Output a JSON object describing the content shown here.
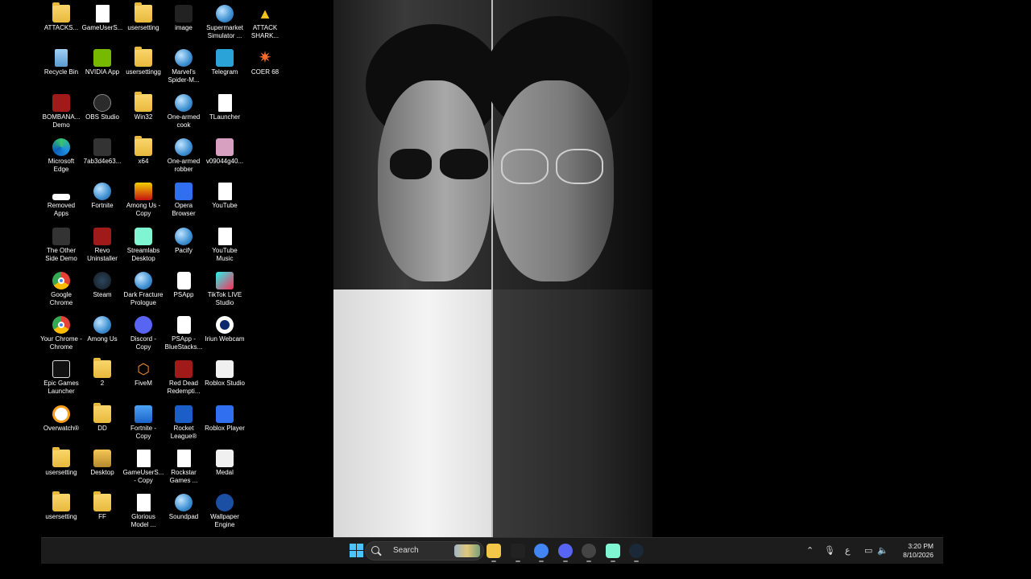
{
  "desktop": {
    "columns": [
      [
        {
          "label": "ATTACKS...",
          "icon": "folder-icon",
          "type": "folder"
        },
        {
          "label": "Recycle Bin",
          "icon": "recycle-bin-icon",
          "type": "recycle"
        },
        {
          "label": "BOMBANA... Demo",
          "icon": "car-game-icon",
          "type": "red"
        },
        {
          "label": "Microsoft Edge",
          "icon": "edge-icon",
          "type": "edge"
        },
        {
          "label": "Removed Apps",
          "icon": "removed-apps-icon",
          "type": "white-sq"
        },
        {
          "label": "The Other Side Demo",
          "icon": "tos-icon",
          "type": "dark"
        },
        {
          "label": "Google Chrome",
          "icon": "chrome-icon",
          "type": "chrome"
        },
        {
          "label": "Your Chrome - Chrome",
          "icon": "chrome-profile-icon",
          "type": "chrome"
        },
        {
          "label": "Epic Games Launcher",
          "icon": "epic-games-icon",
          "type": "epic"
        },
        {
          "label": "Overwatch®",
          "icon": "overwatch-icon",
          "type": "overwatch"
        },
        {
          "label": "usersetting",
          "icon": "folder-icon",
          "type": "folder"
        },
        {
          "label": "usersetting",
          "icon": "folder-icon",
          "type": "folder"
        }
      ],
      [
        {
          "label": "GameUserS...",
          "icon": "settings-file-icon",
          "type": "doc"
        },
        {
          "label": "NVIDIA App",
          "icon": "nvidia-icon",
          "type": "nvidia"
        },
        {
          "label": "OBS Studio",
          "icon": "obs-icon",
          "type": "obs"
        },
        {
          "label": "7ab3d4e63...",
          "icon": "app-icon",
          "type": "dark"
        },
        {
          "label": "Fortnite",
          "icon": "globe-icon",
          "type": "globe"
        },
        {
          "label": "Revo Uninstaller",
          "icon": "revo-icon",
          "type": "red"
        },
        {
          "label": "Steam",
          "icon": "steam-icon",
          "type": "steam"
        },
        {
          "label": "Among Us",
          "icon": "globe-icon",
          "type": "globe"
        },
        {
          "label": "2",
          "icon": "folder-icon",
          "type": "folder"
        },
        {
          "label": "DD",
          "icon": "folder-icon",
          "type": "folder"
        },
        {
          "label": "Desktop",
          "icon": "desktop-folder-icon",
          "type": "desktop-ico"
        },
        {
          "label": "FF",
          "icon": "folder-icon",
          "type": "folder"
        }
      ],
      [
        {
          "label": "usersetting",
          "icon": "folder-icon",
          "type": "folder"
        },
        {
          "label": "usersettingg",
          "icon": "folder-icon",
          "type": "folder"
        },
        {
          "label": "Win32",
          "icon": "folder-icon",
          "type": "folder"
        },
        {
          "label": "x64",
          "icon": "folder-icon",
          "type": "folder"
        },
        {
          "label": "Among Us - Copy",
          "icon": "among-us-icon",
          "type": "among-copy"
        },
        {
          "label": "Streamlabs Desktop",
          "icon": "streamlabs-icon",
          "type": "streamlabs"
        },
        {
          "label": "Dark Fracture Prologue",
          "icon": "globe-icon",
          "type": "globe"
        },
        {
          "label": "Discord - Copy",
          "icon": "discord-icon",
          "type": "discord"
        },
        {
          "label": "FiveM",
          "icon": "fivem-icon",
          "type": "fivem"
        },
        {
          "label": "Fortnite - Copy",
          "icon": "fortnite-copy-icon",
          "type": "fortnite-copy"
        },
        {
          "label": "GameUserS... - Copy",
          "icon": "settings-file-icon",
          "type": "doc"
        },
        {
          "label": "Glorious Model ...",
          "icon": "file-icon",
          "type": "doc"
        }
      ],
      [
        {
          "label": "image",
          "icon": "image-icon",
          "type": "image-icon"
        },
        {
          "label": "Marvel's Spider-M...",
          "icon": "globe-icon",
          "type": "globe"
        },
        {
          "label": "One-armed cook",
          "icon": "globe-icon",
          "type": "globe"
        },
        {
          "label": "One-armed robber",
          "icon": "globe-icon",
          "type": "globe"
        },
        {
          "label": "Opera Browser",
          "icon": "opera-icon",
          "type": "roblox"
        },
        {
          "label": "Pacify",
          "icon": "globe-icon",
          "type": "globe"
        },
        {
          "label": "PSApp",
          "icon": "file-icon",
          "type": "psapp"
        },
        {
          "label": "PSApp - BlueStacks...",
          "icon": "file-icon",
          "type": "psapp"
        },
        {
          "label": "Red Dead Redempti...",
          "icon": "rdr-icon",
          "type": "red"
        },
        {
          "label": "Rocket League®",
          "icon": "rocket-league-icon",
          "type": "rocket"
        },
        {
          "label": "Rockstar Games ...",
          "icon": "file-icon",
          "type": "doc"
        },
        {
          "label": "Soundpad",
          "icon": "globe-icon",
          "type": "globe"
        }
      ],
      [
        {
          "label": "Supermarket Simulator ...",
          "icon": "globe-icon",
          "type": "globe"
        },
        {
          "label": "Telegram",
          "icon": "telegram-icon",
          "type": "telegram"
        },
        {
          "label": "TLauncher",
          "icon": "file-icon",
          "type": "doc"
        },
        {
          "label": "v09044g40...",
          "icon": "video-file-icon",
          "type": "pink"
        },
        {
          "label": "YouTube",
          "icon": "file-icon",
          "type": "doc"
        },
        {
          "label": "YouTube Music",
          "icon": "file-icon",
          "type": "doc"
        },
        {
          "label": "TikTok LIVE Studio",
          "icon": "tiktok-icon",
          "type": "tiktok"
        },
        {
          "label": "Iriun Webcam",
          "icon": "iriun-icon",
          "type": "iriun"
        },
        {
          "label": "Roblox Studio",
          "icon": "roblox-studio-icon",
          "type": "medal"
        },
        {
          "label": "Roblox Player",
          "icon": "roblox-icon",
          "type": "roblox"
        },
        {
          "label": "Medal",
          "icon": "medal-icon",
          "type": "medal"
        },
        {
          "label": "Wallpaper Engine",
          "icon": "wallpaper-engine-icon",
          "type": "wallpaper-engine"
        }
      ],
      [
        {
          "label": "ATTACK SHARK...",
          "icon": "attack-shark-icon",
          "type": "attack"
        },
        {
          "label": "COER 68",
          "icon": "coer-icon",
          "type": "coer"
        }
      ]
    ]
  },
  "taskbar": {
    "search_label": "Search",
    "pinned": [
      {
        "name": "file-explorer",
        "icon": "folder-icon",
        "color": "#f2c649"
      },
      {
        "name": "epic-games",
        "icon": "epic-games-icon",
        "color": "#222222"
      },
      {
        "name": "chrome",
        "icon": "chrome-icon",
        "color": "#4285f4"
      },
      {
        "name": "discord",
        "icon": "discord-icon",
        "color": "#5865f2"
      },
      {
        "name": "obs",
        "icon": "obs-icon",
        "color": "#444444"
      },
      {
        "name": "streamlabs",
        "icon": "streamlabs-icon",
        "color": "#80f5d2"
      },
      {
        "name": "steam",
        "icon": "steam-icon",
        "color": "#1b2838"
      }
    ],
    "tray": {
      "language": "ع",
      "time": "3:20 PM",
      "date": "8/10/2026"
    }
  }
}
